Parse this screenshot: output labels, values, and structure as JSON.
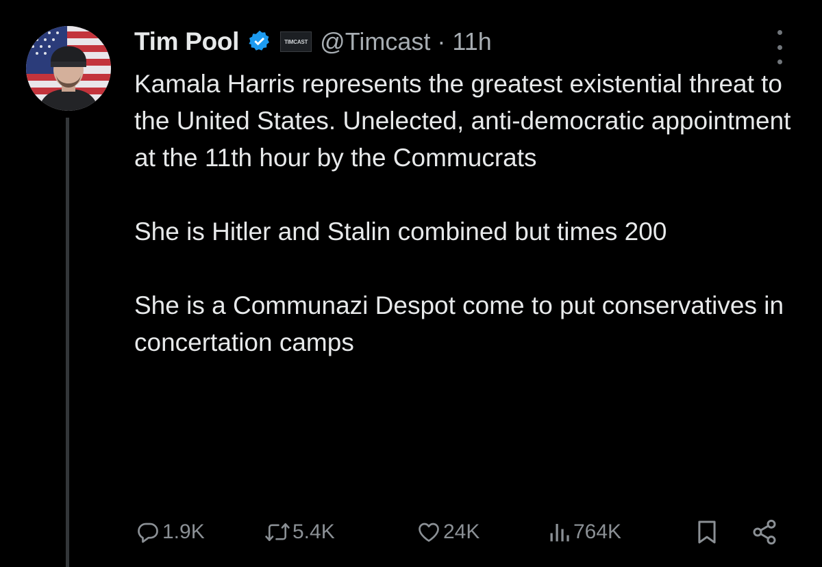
{
  "tweet": {
    "author": {
      "display_name": "Tim Pool",
      "affiliate_badge": "TIMCAST",
      "handle": "@Timcast",
      "separator": "·",
      "time": "11h"
    },
    "paragraphs": [
      "Kamala Harris represents the greatest existential threat to the United States. Unelected, anti-democratic appointment at the 11th hour by the Commucrats",
      "She is Hitler and Stalin combined but times 200",
      "She is a Communazi Despot come to put conservatives in concertation camps"
    ],
    "actions": {
      "replies": "1.9K",
      "reposts": "5.4K",
      "likes": "24K",
      "views": "764K"
    }
  },
  "icons": {
    "verified": "verified-badge-icon",
    "more": "more-options-icon",
    "reply": "reply-icon",
    "repost": "repost-icon",
    "like": "like-icon",
    "views": "views-icon",
    "bookmark": "bookmark-icon",
    "share": "share-icon"
  },
  "colors": {
    "background": "#000000",
    "text": "#e7e9ea",
    "secondary": "#a7adb2",
    "verified": "#1d9bf0"
  }
}
